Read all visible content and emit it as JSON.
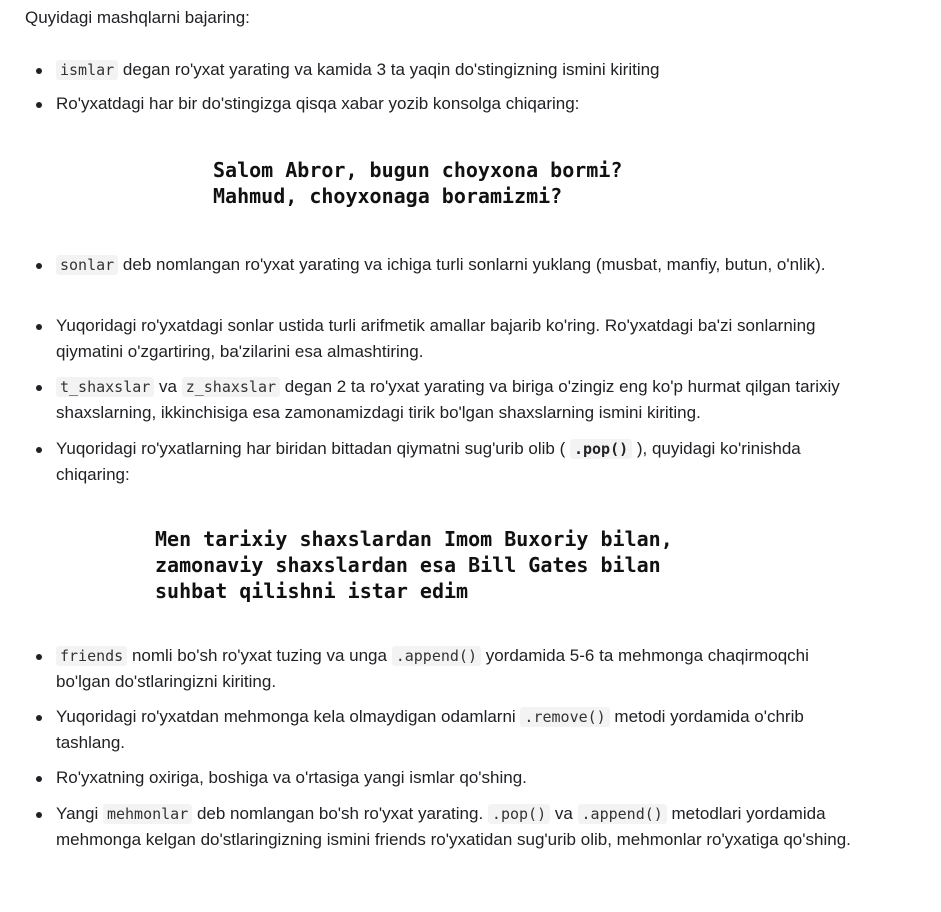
{
  "intro": "Quyidagi mashqlarni bajaring:",
  "items": [
    {
      "code1": "ismlar",
      "text1": " degan ro'yxat yarating va kamida 3 ta yaqin do'stingizning ismini kiriting"
    },
    {
      "text1": "Ro'yxatdagi har bir do'stingizga qisqa xabar yozib konsolga chiqaring:"
    },
    {
      "code1": "sonlar",
      "text1": " deb nomlangan ro'yxat yarating va ichiga turli sonlarni yuklang (musbat, manfiy, butun, o'nlik)."
    },
    {
      "text1": "Yuqoridagi ro'yxatdagi sonlar ustida turli arifmetik amallar bajarib ko'ring. Ro'yxatdagi ba'zi sonlarning qiymatini o'zgartiring, ba'zilarini esa almashtiring."
    },
    {
      "code1": "t_shaxslar",
      "text1": " va ",
      "code2": "z_shaxslar",
      "text2": " degan 2 ta ro'yxat yarating va biriga o'zingiz eng ko'p hurmat qilgan tarixiy shaxslarning, ikkinchisiga esa zamonamizdagi tirik bo'lgan shaxslarning ismini kiriting."
    },
    {
      "text1": "Yuqoridagi ro'yxatlarning har biridan bittadan qiymatni sug'urib olib ( ",
      "code1": ".pop()",
      "text2": " ), quyidagi ko'rinishda chiqaring:"
    },
    {
      "code1": "friends",
      "text1": " nomli bo'sh ro'yxat tuzing va unga ",
      "code2": ".append()",
      "text2": " yordamida 5-6 ta mehmonga chaqirmoqchi bo'lgan do'stlaringizni kiriting."
    },
    {
      "text1": "Yuqoridagi ro'yxatdan mehmonga kela olmaydigan odamlarni ",
      "code1": ".remove()",
      "text2": " metodi yordamida o'chrib tashlang."
    },
    {
      "text1": "Ro'yxatning oxiriga, boshiga va o'rtasiga yangi ismlar qo'shing."
    },
    {
      "text1": "Yangi ",
      "code1": "mehmonlar",
      "text2": " deb nomlangan bo'sh ro'yxat yarating. ",
      "code2": ".pop()",
      "text3": " va ",
      "code3": ".append()",
      "text4": " metodlari yordamida mehmonga kelgan do'stlaringizning ismini friends ro'yxatidan sug'urib olib, mehmonlar ro'yxatiga qo'shing."
    }
  ],
  "example1": [
    "Salom Abror, bugun choyxona bormi?",
    "Mahmud, choyxonaga boramizmi?"
  ],
  "example2": [
    "Men tarixiy shaxslardan Imom Buxoriy bilan,",
    "zamonaviy shaxslardan esa Bill Gates bilan",
    "suhbat qilishni istar edim"
  ]
}
